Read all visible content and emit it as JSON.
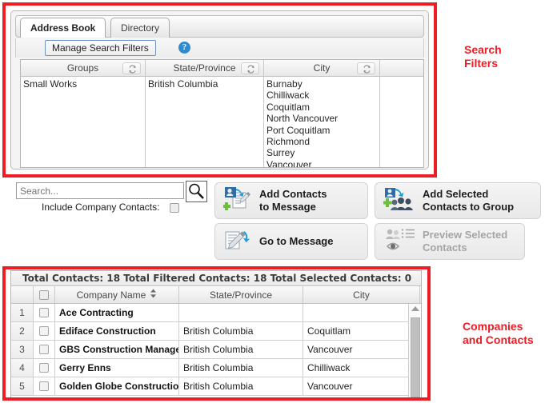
{
  "annotations": {
    "search_filters_label": "Search\nFilters",
    "companies_label": "Companies\nand Contacts",
    "color": "#ee1c25"
  },
  "tabs": [
    {
      "label": "Address Book",
      "active": true
    },
    {
      "label": "Directory",
      "active": false
    }
  ],
  "filter_toolbar": {
    "manage_button": "Manage Search Filters",
    "help_icon": "help-icon",
    "help_glyph": "?"
  },
  "filter_table": {
    "columns": [
      {
        "label": "Groups",
        "refresh": true
      },
      {
        "label": "State/Province",
        "refresh": true
      },
      {
        "label": "City",
        "refresh": true
      },
      {
        "label": "",
        "refresh": false
      }
    ],
    "groups": [
      "Small Works"
    ],
    "states": [
      "British Columbia"
    ],
    "cities": [
      "Burnaby",
      "Chilliwack",
      "Coquitlam",
      "North Vancouver",
      "Port Coquitlam",
      "Richmond",
      "Surrey",
      "Vancouver"
    ],
    "extra": []
  },
  "search": {
    "value": "",
    "placeholder": "Search...",
    "button_icon": "magnifier-icon",
    "include_company_contacts_label": "Include Company Contacts:",
    "include_company_contacts_checked": false
  },
  "actions": [
    {
      "id": "add-contacts-to-message",
      "label": "Add Contacts\nto Message",
      "icon": "add-contact-message-icon",
      "disabled": false
    },
    {
      "id": "add-selected-contacts-to-group",
      "label": "Add Selected\nContacts to Group",
      "icon": "add-contacts-group-icon",
      "disabled": false
    },
    {
      "id": "go-to-message",
      "label": "Go to Message",
      "icon": "go-to-message-icon",
      "disabled": false
    },
    {
      "id": "preview-selected-contacts",
      "label": "Preview Selected\nContacts",
      "icon": "preview-contacts-icon",
      "disabled": true
    }
  ],
  "contacts": {
    "totals": "Total Contacts: 18  Total Filtered Contacts: 18  Total Selected Contacts: 0",
    "total_contacts": 18,
    "total_filtered_contacts": 18,
    "total_selected_contacts": 0,
    "columns": [
      "",
      "",
      "Company Name",
      "State/Province",
      "City"
    ],
    "sort_column": "Company Name",
    "sort_glyph": "sort-arrows-icon",
    "select_all_checked": false,
    "rows": [
      {
        "num": "1",
        "checked": false,
        "company": "Ace Contracting",
        "state": "",
        "city": ""
      },
      {
        "num": "2",
        "checked": false,
        "company": "Ediface Construction",
        "state": "British Columbia",
        "city": "Coquitlam"
      },
      {
        "num": "3",
        "checked": false,
        "company": "GBS Construction Manage",
        "state": "British Columbia",
        "city": "Vancouver"
      },
      {
        "num": "4",
        "checked": false,
        "company": "Gerry Enns",
        "state": "British Columbia",
        "city": "Chilliwack"
      },
      {
        "num": "5",
        "checked": false,
        "company": "Golden Globe Construction",
        "state": "British Columbia",
        "city": "Vancouver"
      }
    ]
  }
}
